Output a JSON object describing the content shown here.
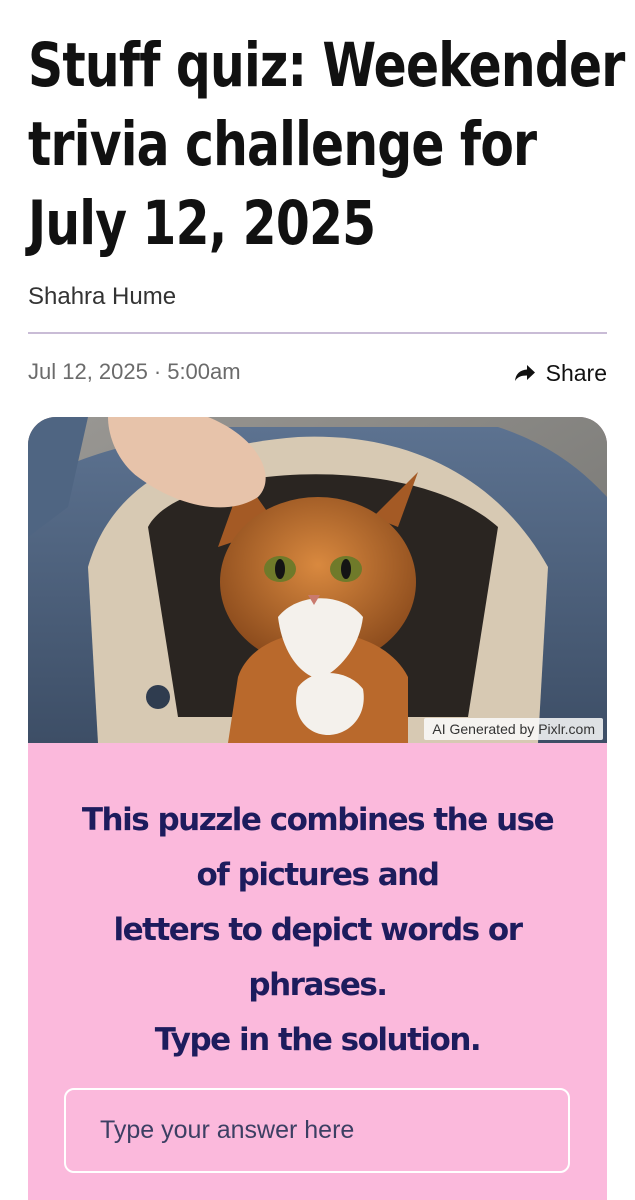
{
  "article": {
    "headline": "Stuff quiz: Weekender trivia challenge for July 12, 2025",
    "headline_lines": [
      "Stuff quiz: Weekender",
      "trivia challenge for",
      "July 12, 2025"
    ],
    "author": "Shahra Hume",
    "date": "Jul 12, 2025",
    "separator": "·",
    "time": "5:00am",
    "share_label": "Share",
    "share_icon": "share-arrow-icon"
  },
  "image": {
    "credit": "AI Generated by Pixlr.com"
  },
  "puzzle": {
    "instructions": [
      "This puzzle combines the use",
      "of pictures and",
      "letters to depict words or",
      "phrases.",
      "Type in the solution."
    ],
    "answer_placeholder": "Type your answer here",
    "answer_value": ""
  },
  "colors": {
    "puzzle_background": "#fbb9dc",
    "puzzle_text": "#1d1c5d",
    "divider": "#c9bcd6",
    "headline": "#111111"
  }
}
